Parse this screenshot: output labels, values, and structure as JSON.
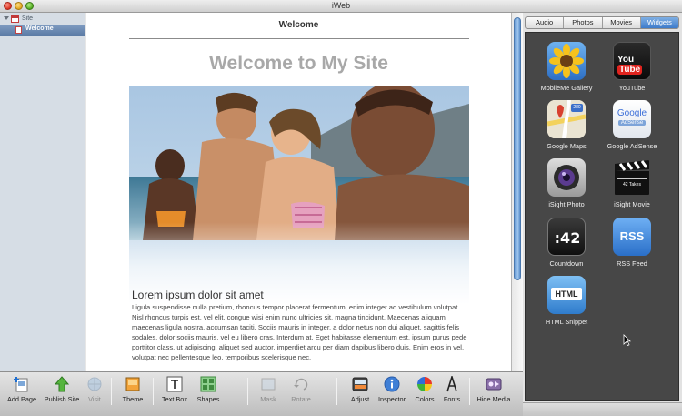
{
  "window": {
    "title": "iWeb"
  },
  "sidebar": {
    "site_label": "Site",
    "page_label": "Welcome"
  },
  "canvas": {
    "page_name": "Welcome",
    "heading": "Welcome to My Site",
    "article_title": "Lorem ipsum dolor sit amet",
    "article_body": "Ligula suspendisse nulla pretium, rhoncus tempor placerat fermentum, enim integer ad vestibulum volutpat. Nisl rhoncus turpis est, vel elit, congue wisi enim nunc ultricies sit, magna tincidunt. Maecenas aliquam maecenas ligula nostra, accumsan taciti. Sociis mauris in integer, a dolor netus non dui aliquet, sagittis felis sodales, dolor sociis mauris, vel eu libero cras. Interdum at. Eget habitasse elementum est, ipsum purus pede porttitor class, ut adipiscing, aliquet sed auctor, imperdiet arcu per diam dapibus libero duis. Enim eros in vel, volutpat nec pellentesque leo, temporibus scelerisque nec."
  },
  "media_panel": {
    "tabs": [
      "Audio",
      "Photos",
      "Movies",
      "Widgets"
    ],
    "active_tab": "Widgets",
    "widgets": [
      {
        "label": "MobileMe Gallery",
        "icon": "sunflower-icon"
      },
      {
        "label": "YouTube",
        "icon": "youtube-icon",
        "icon_text_a": "You",
        "icon_text_b": "Tube"
      },
      {
        "label": "Google Maps",
        "icon": "google-maps-icon",
        "icon_text": "280"
      },
      {
        "label": "Google AdSense",
        "icon": "google-adsense-icon",
        "icon_text": "Google",
        "icon_sub": "AdSense"
      },
      {
        "label": "iSight Photo",
        "icon": "camera-icon"
      },
      {
        "label": "iSight Movie",
        "icon": "clapperboard-icon",
        "icon_text": "42 Takes"
      },
      {
        "label": "Countdown",
        "icon": "countdown-icon",
        "icon_text": ":42"
      },
      {
        "label": "RSS Feed",
        "icon": "rss-icon",
        "icon_text": "RSS"
      },
      {
        "label": "HTML Snippet",
        "icon": "html-snippet-icon",
        "icon_text": "HTML"
      }
    ]
  },
  "toolbar": {
    "add_page": "Add Page",
    "publish_site": "Publish Site",
    "visit": "Visit",
    "theme": "Theme",
    "text_box": "Text Box",
    "shapes": "Shapes",
    "mask": "Mask",
    "rotate": "Rotate",
    "adjust": "Adjust",
    "inspector": "Inspector",
    "colors": "Colors",
    "fonts": "Fonts",
    "hide_media": "Hide Media"
  },
  "colors": {
    "accent_blue": "#3e7ccb",
    "heading_gray": "#a8a8a8",
    "media_background": "#474747"
  }
}
